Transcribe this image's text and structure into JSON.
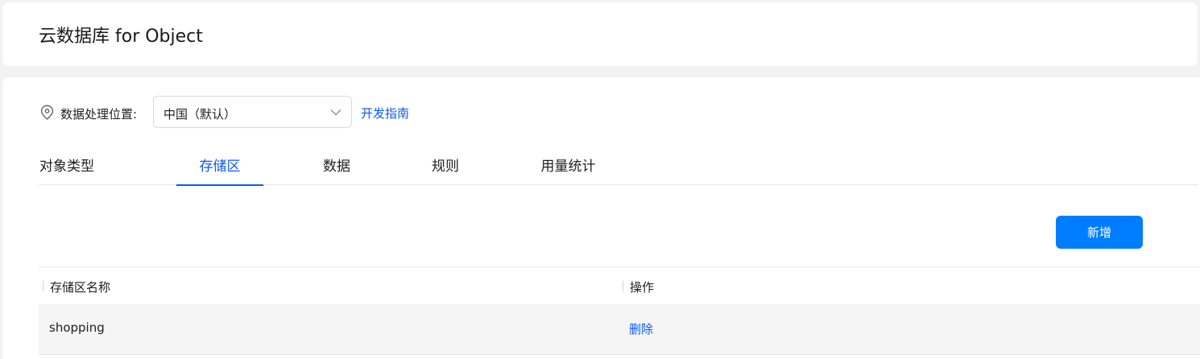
{
  "page": {
    "title": "云数据库 for Object"
  },
  "location": {
    "label": "数据处理位置:",
    "selected_region": "中国（默认）",
    "guide_link": "开发指南"
  },
  "tabs": [
    {
      "label": "对象类型",
      "active": false
    },
    {
      "label": "存储区",
      "active": true
    },
    {
      "label": "数据",
      "active": false
    },
    {
      "label": "规则",
      "active": false
    },
    {
      "label": "用量统计",
      "active": false
    }
  ],
  "toolbar": {
    "add_label": "新增"
  },
  "table": {
    "columns": [
      "存储区名称",
      "操作"
    ],
    "rows": [
      {
        "name": "shopping",
        "action": "删除"
      }
    ]
  },
  "colors": {
    "accent": "#0a59f7",
    "button": "#007dff"
  }
}
